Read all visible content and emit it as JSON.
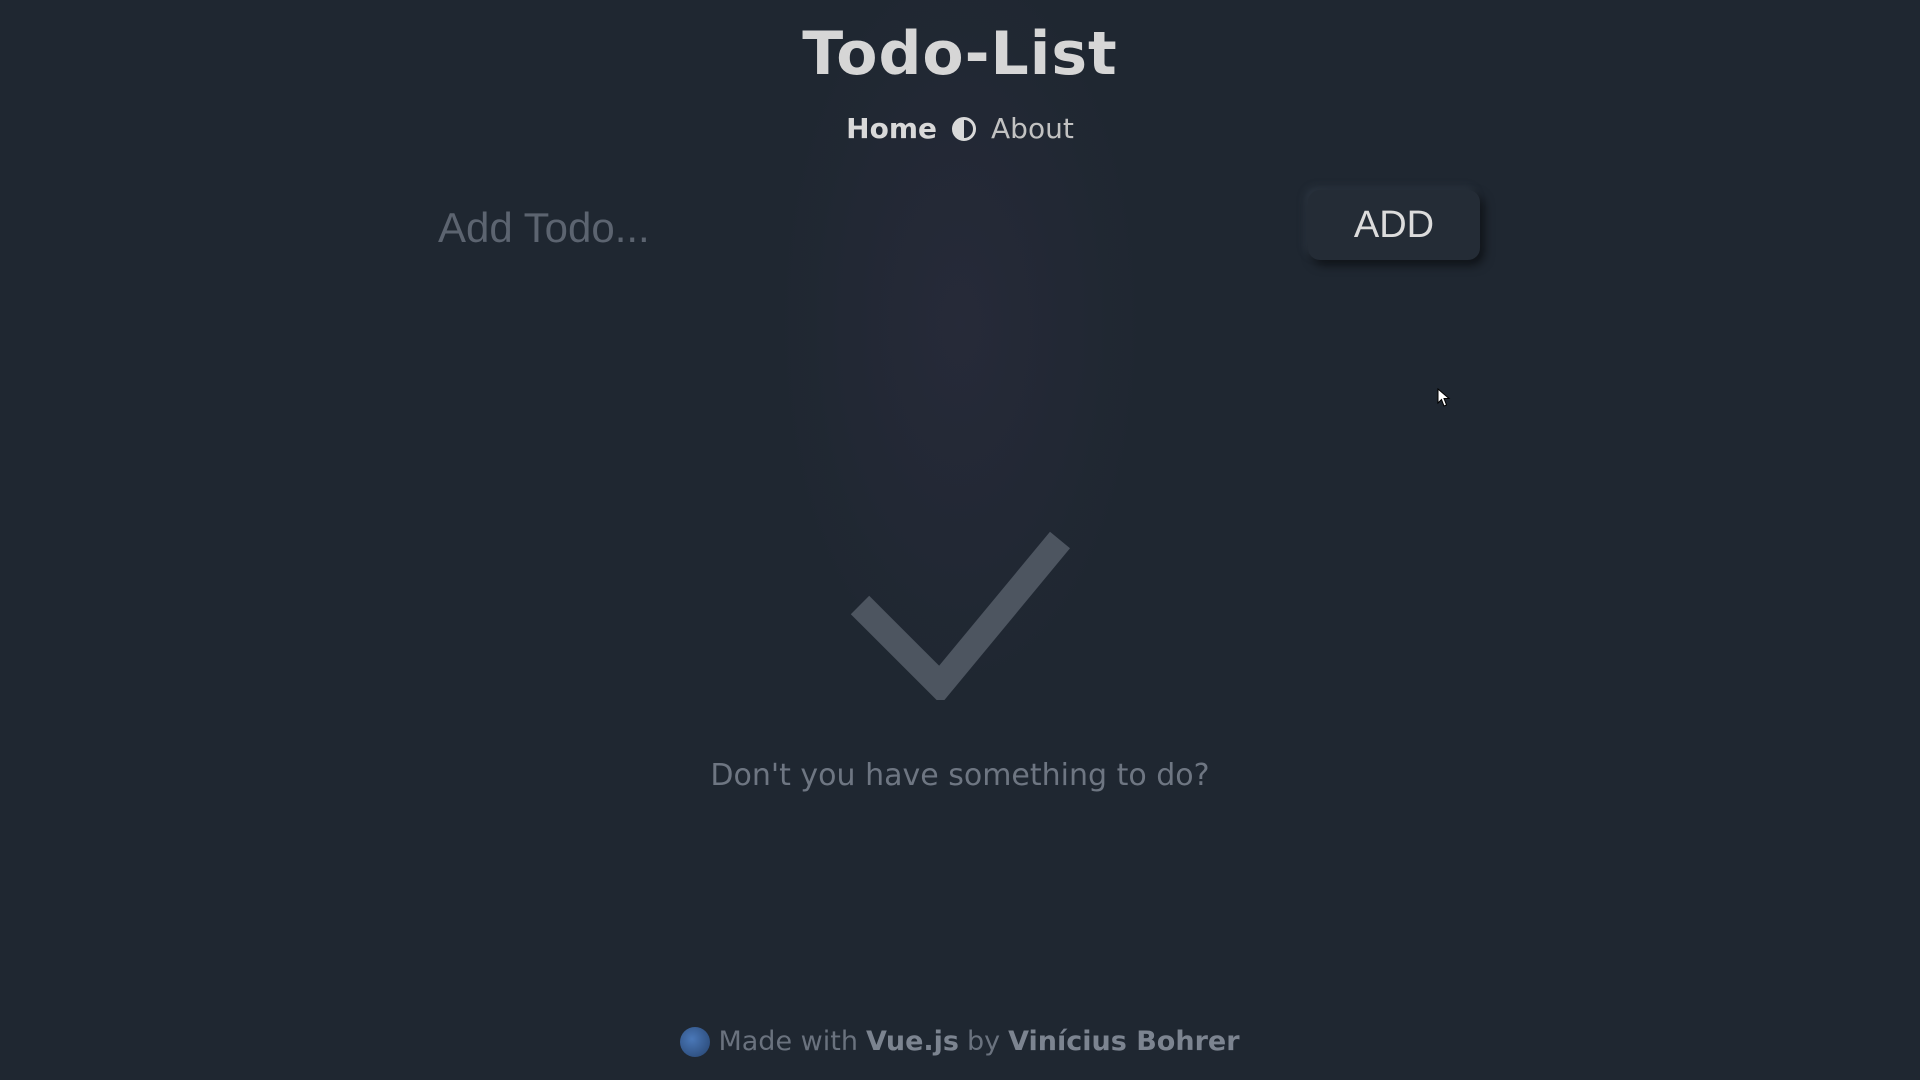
{
  "header": {
    "title": "Todo-List",
    "nav": {
      "home": "Home",
      "about": "About",
      "theme_icon": "half-circle-contrast-icon"
    }
  },
  "add_todo": {
    "placeholder": "Add Todo...",
    "value": "",
    "button_label": "ADD"
  },
  "empty_state": {
    "icon": "checkmark-icon",
    "message": "Don't you have something to do?"
  },
  "footer": {
    "icon": "globe-icon",
    "made_with": "Made with",
    "framework": "Vue.js",
    "by": "by",
    "author": "Vinícius Bohrer"
  },
  "colors": {
    "background": "#1f2731",
    "text_primary": "#d6d6d6",
    "text_muted": "#6e7682",
    "checkmark": "#4d5560"
  }
}
